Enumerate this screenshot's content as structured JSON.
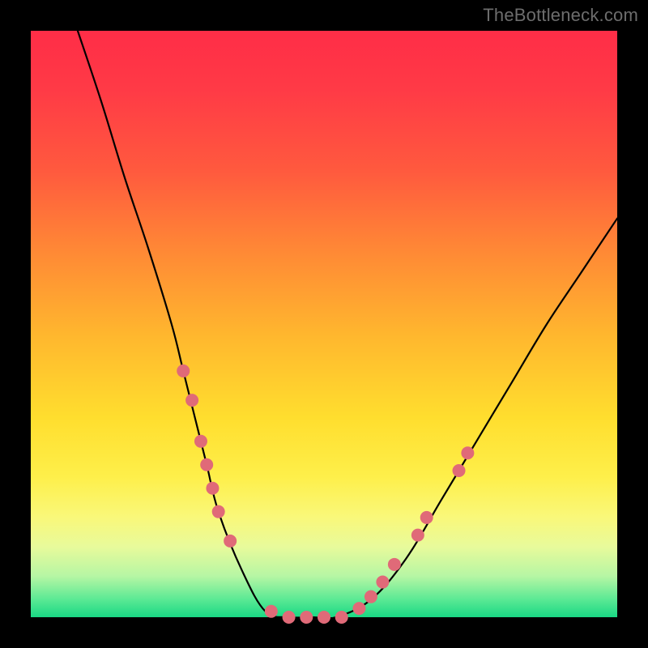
{
  "watermark": "TheBottleneck.com",
  "chart_data": {
    "type": "line",
    "title": "",
    "xlabel": "",
    "ylabel": "",
    "xlim": [
      0,
      100
    ],
    "ylim": [
      0,
      100
    ],
    "series": [
      {
        "name": "bottleneck-curve",
        "x": [
          8,
          12,
          16,
          20,
          24,
          26,
          28,
          30,
          32,
          36,
          40,
          44,
          48,
          52,
          58,
          64,
          70,
          76,
          82,
          88,
          94,
          100
        ],
        "y": [
          100,
          88,
          75,
          63,
          50,
          42,
          34,
          26,
          18,
          8,
          1,
          0,
          0,
          0,
          3,
          10,
          20,
          30,
          40,
          50,
          59,
          68
        ]
      }
    ],
    "flat_bottom": {
      "x_start": 42,
      "x_end": 55,
      "y": 0
    },
    "markers": {
      "name": "highlight-dots",
      "color": "#e06a78",
      "radius_px": 8,
      "points": [
        {
          "x": 26.0,
          "y": 42
        },
        {
          "x": 27.5,
          "y": 37
        },
        {
          "x": 29.0,
          "y": 30
        },
        {
          "x": 30.0,
          "y": 26
        },
        {
          "x": 31.0,
          "y": 22
        },
        {
          "x": 32.0,
          "y": 18
        },
        {
          "x": 34.0,
          "y": 13
        },
        {
          "x": 41.0,
          "y": 1
        },
        {
          "x": 44.0,
          "y": 0
        },
        {
          "x": 47.0,
          "y": 0
        },
        {
          "x": 50.0,
          "y": 0
        },
        {
          "x": 53.0,
          "y": 0
        },
        {
          "x": 56.0,
          "y": 1.5
        },
        {
          "x": 58.0,
          "y": 3.5
        },
        {
          "x": 60.0,
          "y": 6
        },
        {
          "x": 62.0,
          "y": 9
        },
        {
          "x": 66.0,
          "y": 14
        },
        {
          "x": 67.5,
          "y": 17
        },
        {
          "x": 73.0,
          "y": 25
        },
        {
          "x": 74.5,
          "y": 28
        }
      ]
    },
    "background_gradient": {
      "top": "#ff2d47",
      "mid": "#ffde2e",
      "bottom": "#19d884"
    }
  }
}
